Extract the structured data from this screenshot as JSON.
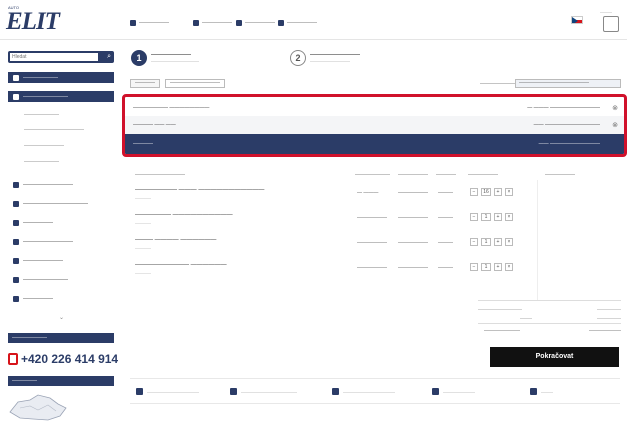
{
  "header": {
    "logo_sup": "AUTO",
    "logo": "ELIT",
    "nav": [
      "——————",
      "——————",
      "——————",
      "——————"
    ],
    "cart_label": "———"
  },
  "search": {
    "placeholder": "Hledat"
  },
  "sidebar": {
    "items": [
      {
        "label": "———————",
        "style": "dark"
      },
      {
        "label": "—————————",
        "style": "dark"
      },
      {
        "label": "———————",
        "style": "sub"
      },
      {
        "label": "————————————",
        "style": "sub"
      },
      {
        "label": "————————",
        "style": "sub"
      },
      {
        "label": "———————",
        "style": "sub"
      },
      {
        "label": "——————————",
        "style": "item"
      },
      {
        "label": "—————————————",
        "style": "item"
      },
      {
        "label": "——————",
        "style": "item"
      },
      {
        "label": "——————————",
        "style": "item"
      },
      {
        "label": "————————",
        "style": "item"
      },
      {
        "label": "—————————",
        "style": "item"
      },
      {
        "label": "——————",
        "style": "item"
      }
    ],
    "phone_band": "———————",
    "phone": "+420 226 414 914",
    "map_band": "—————"
  },
  "steps": [
    {
      "num": "1",
      "title": "————————",
      "sub": "————————————"
    },
    {
      "num": "2",
      "title": "——————————",
      "sub": "——————————"
    }
  ],
  "controls": {
    "back": "————",
    "continue": "——————————",
    "currency_label": "————————",
    "currency_value": "——————————————"
  },
  "summary": {
    "rows": [
      {
        "label": "———————  ————————",
        "sum": "— ——— ——————————"
      },
      {
        "label": "————  —— ——",
        "sum": "—— ———————————"
      },
      {
        "label": "————",
        "sum": "—— ——————————"
      }
    ]
  },
  "table": {
    "headers": [
      "——————————",
      "———————",
      "——————",
      "————",
      "——————",
      "——————"
    ],
    "rows": [
      {
        "name": "——————— ——— ———————————",
        "code": "————",
        "price": "— ———",
        "total": "——————",
        "stock": "———",
        "qty": "16"
      },
      {
        "name": "—————— ——————————",
        "code": "————",
        "price": "——————",
        "total": "——————",
        "stock": "———",
        "qty": "1"
      },
      {
        "name": "——— ———— ——————",
        "code": "————",
        "price": "——————",
        "total": "——————",
        "stock": "———",
        "qty": "1"
      },
      {
        "name": "————————— ——————",
        "code": "————",
        "price": "——————",
        "total": "——————",
        "stock": "———",
        "qty": "1"
      }
    ]
  },
  "totals": [
    {
      "label": "———————————",
      "value": "——————"
    },
    {
      "label": "———",
      "value": "——————"
    },
    {
      "label": "—————————",
      "value": "————————"
    }
  ],
  "order_button": "Pokračovat",
  "features": [
    "—————————————",
    "——————————————",
    "—————————————",
    "————————",
    "———"
  ],
  "colors": {
    "brand": "#2b3c67",
    "highlight": "#d0112b",
    "order": "#111111"
  }
}
